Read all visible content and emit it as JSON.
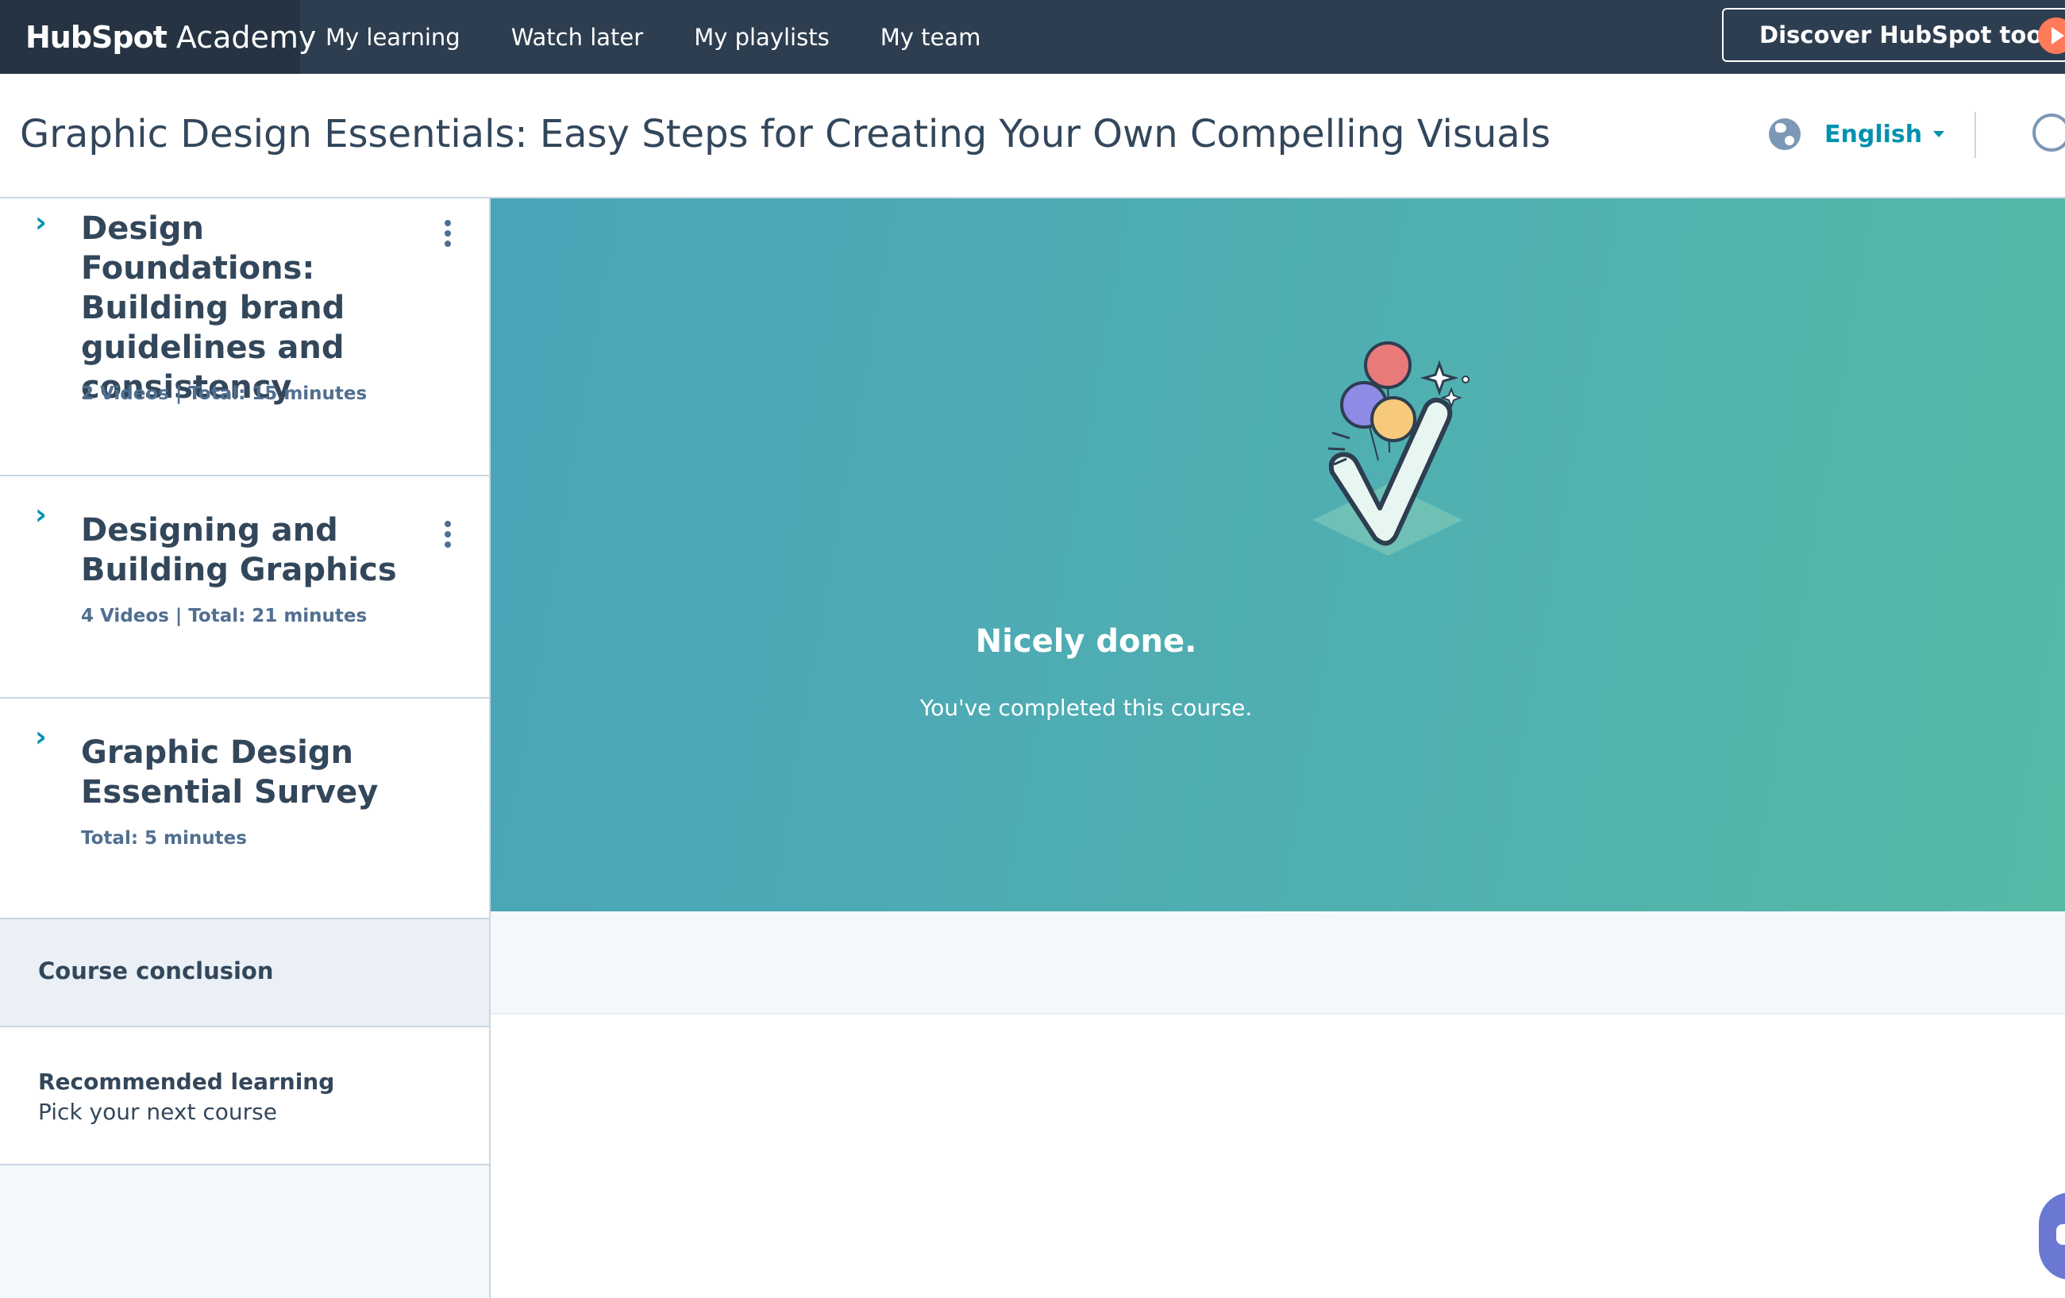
{
  "brand": {
    "logo_text": "HubSpot",
    "product": "Academy"
  },
  "nav": {
    "items": [
      "My learning",
      "Watch later",
      "My playlists",
      "My team"
    ],
    "cta": "Discover HubSpot tools"
  },
  "header": {
    "title": "Graphic Design Essentials: Easy Steps for Creating Your Own Compelling Visuals",
    "language": "English"
  },
  "sidebar": {
    "sections": [
      {
        "title": "Design Foundations: Building brand guidelines and consistency",
        "meta": "2 Videos | Total: 15 minutes"
      },
      {
        "title": "Designing and Building Graphics",
        "meta": "4 Videos | Total: 21 minutes"
      },
      {
        "title": "Graphic Design Essential Survey",
        "meta": "Total: 5 minutes"
      }
    ],
    "conclusion": "Course conclusion",
    "recommended": {
      "title": "Recommended learning",
      "subtitle": "Pick your next course"
    }
  },
  "main": {
    "title": "Nicely done.",
    "subtitle": "You've completed this course."
  },
  "colors": {
    "nav_bg": "#2d3e50",
    "brand_bg": "#253342",
    "accent": "#0091ae",
    "hero_start": "#4aa4b8",
    "hero_end": "#56b9a5",
    "cta_play": "#ff7a59"
  }
}
